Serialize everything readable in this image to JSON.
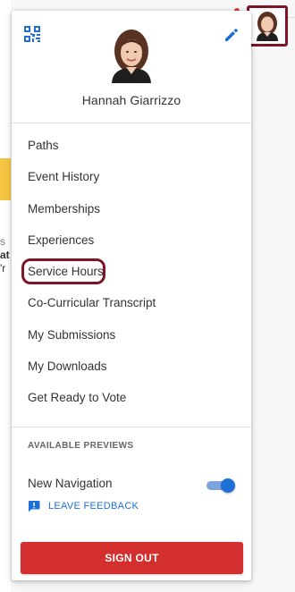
{
  "colors": {
    "accent_blue": "#1e6fd6",
    "signout_red": "#d32f2f",
    "highlight_ring": "#7b1527",
    "text": "#333333"
  },
  "background": {
    "line1": "s",
    "line2": "at",
    "line3": "'r"
  },
  "header": {
    "qr_icon": "qr-code-icon",
    "edit_icon": "pencil-icon",
    "user_name": "Hannah Giarrizzo"
  },
  "menu": {
    "items": [
      {
        "label": "Paths"
      },
      {
        "label": "Event History"
      },
      {
        "label": "Memberships"
      },
      {
        "label": "Experiences"
      },
      {
        "label": "Service Hours"
      },
      {
        "label": "Co-Curricular Transcript"
      },
      {
        "label": "My Submissions"
      },
      {
        "label": "My Downloads"
      },
      {
        "label": "Get Ready to Vote"
      }
    ]
  },
  "previews": {
    "section_title": "AVAILABLE PREVIEWS",
    "new_navigation_label": "New Navigation",
    "new_navigation_enabled": true,
    "feedback_label": "LEAVE FEEDBACK",
    "feedback_icon": "feedback-icon"
  },
  "footer": {
    "signout_label": "SIGN OUT"
  }
}
